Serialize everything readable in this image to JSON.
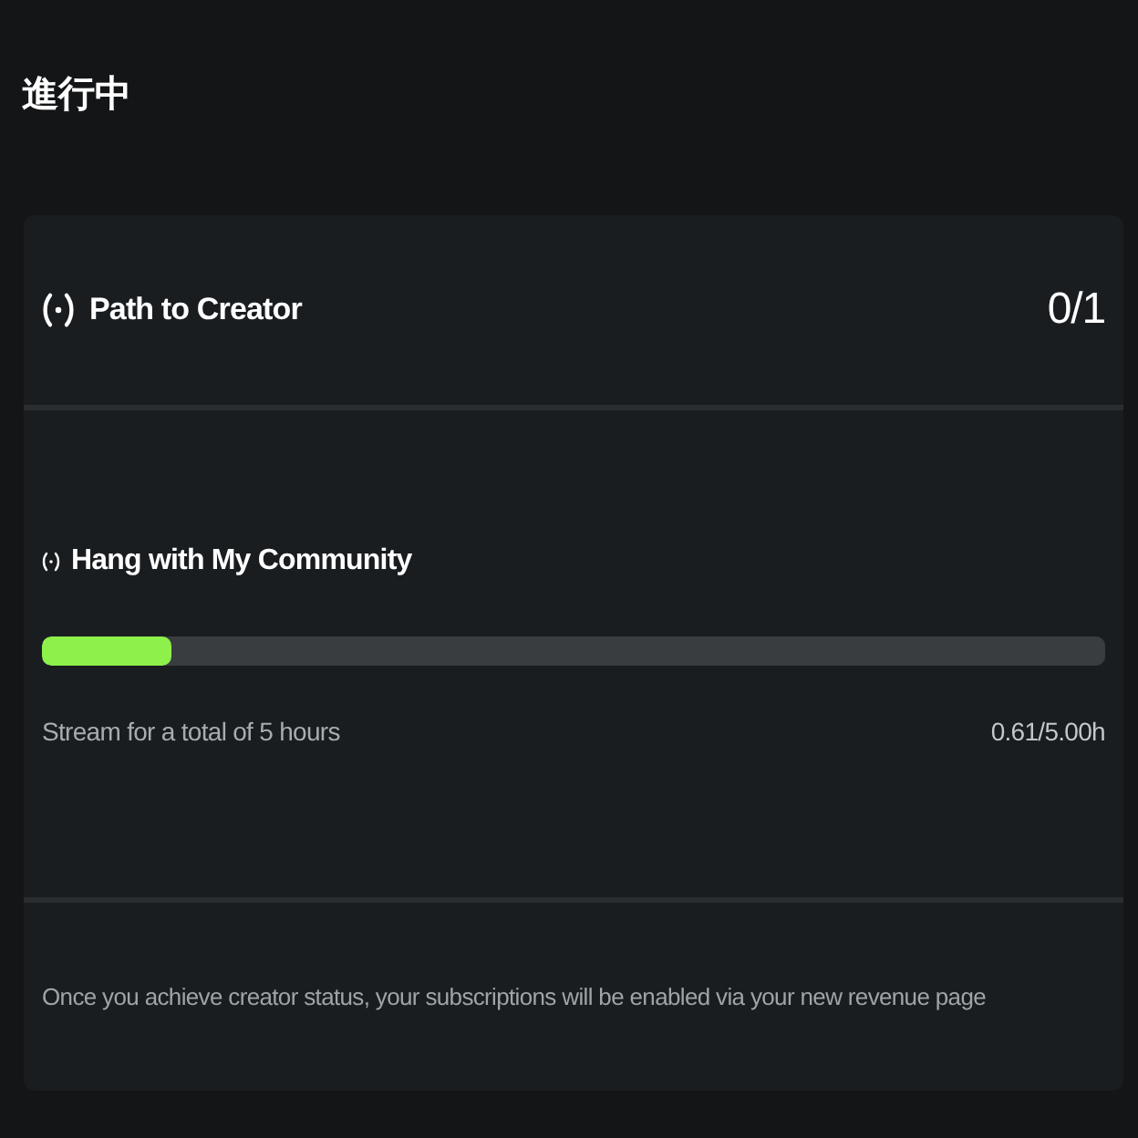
{
  "page": {
    "title": "進行中"
  },
  "card": {
    "header": {
      "title": "Path to Creator",
      "count": "0/1"
    },
    "goals": [
      {
        "title": "Hang with My Community",
        "level": 0.122,
        "description": "Stream for a total of 5 hours",
        "reading": "0.61/5.00h"
      }
    ],
    "footer": "Once you achieve creator status, your subscriptions will be enabled via your new revenue page"
  }
}
